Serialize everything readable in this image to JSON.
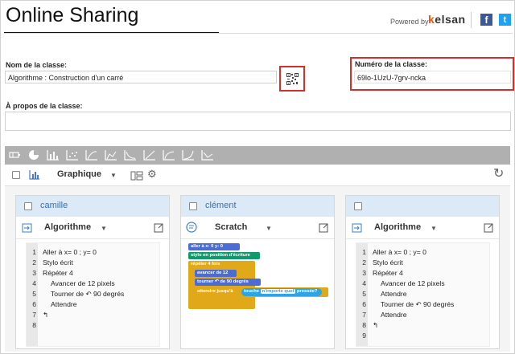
{
  "header": {
    "title": "Online Sharing",
    "powered_by": "Powered by",
    "brand_k": "k",
    "brand_rest": "elsan",
    "facebook": "f",
    "twitter": "t"
  },
  "form": {
    "class_name_label": "Nom de la classe:",
    "class_name_value": "Algorithme : Construction d'un carré",
    "class_number_label": "Numéro de la classe:",
    "class_number_value": "69lo-1UzU-7grv-ncka",
    "about_label": "À propos de la classe:",
    "about_value": ""
  },
  "toolbar": {
    "view_label": "Graphique",
    "icons": [
      "battery-icon",
      "pie-chart-icon",
      "bar-chart-icon",
      "scatter-icon",
      "chart-icon",
      "chart-icon",
      "chart-icon",
      "chart-icon",
      "chart-icon",
      "chart-icon",
      "chart-icon"
    ]
  },
  "cards": [
    {
      "name": "camille",
      "language": "Algorithme",
      "lines": [
        {
          "n": "1",
          "text": "Aller à x= 0 ; y= 0",
          "indent": 0
        },
        {
          "n": "2",
          "text": "Stylo écrit",
          "indent": 0
        },
        {
          "n": "3",
          "text": "Répéter 4",
          "indent": 0
        },
        {
          "n": "4",
          "text": "Avancer de 12 pixels",
          "indent": 1
        },
        {
          "n": "5",
          "text": "Tourner de ↶ 90 degrés",
          "indent": 1
        },
        {
          "n": "6",
          "text": "Attendre",
          "indent": 1
        },
        {
          "n": "7",
          "text": "↰",
          "indent": 0
        },
        {
          "n": "8",
          "text": "",
          "indent": 0
        }
      ]
    },
    {
      "name": "clément",
      "language": "Scratch",
      "blocks": {
        "goto": "aller à x: 0 y: 0",
        "pen": "stylo en position d'écriture",
        "repeat": "répéter 4 fois",
        "move": "avancer de 12",
        "turn": "tourner ↶ de 90 degrés",
        "wait_until": "attendre jusqu'à",
        "touch": "touche",
        "any": "n'importe quel",
        "pressed": "pressée?"
      }
    },
    {
      "name": "",
      "language": "Algorithme",
      "lines": [
        {
          "n": "1",
          "text": "Aller à x= 0 ; y= 0",
          "indent": 0
        },
        {
          "n": "2",
          "text": "Stylo écrit",
          "indent": 0
        },
        {
          "n": "3",
          "text": "Répéter 4",
          "indent": 0
        },
        {
          "n": "4",
          "text": "Avancer de 12 pixels",
          "indent": 1
        },
        {
          "n": "5",
          "text": "Attendre",
          "indent": 1
        },
        {
          "n": "6",
          "text": "Tourner de ↶ 90 degrés",
          "indent": 1
        },
        {
          "n": "7",
          "text": "Attendre",
          "indent": 1
        },
        {
          "n": "8",
          "text": "↰",
          "indent": 0
        },
        {
          "n": "9",
          "text": "",
          "indent": 0
        }
      ]
    }
  ],
  "colors": {
    "accent_red": "#d0312d",
    "card_header": "#dce9f7",
    "toolbar_gray": "#b0b0b0",
    "scratch_motion": "#4a6cd4",
    "scratch_pen": "#0e9a6c",
    "scratch_control": "#e1a91a",
    "scratch_sensing": "#2ca5e2"
  }
}
